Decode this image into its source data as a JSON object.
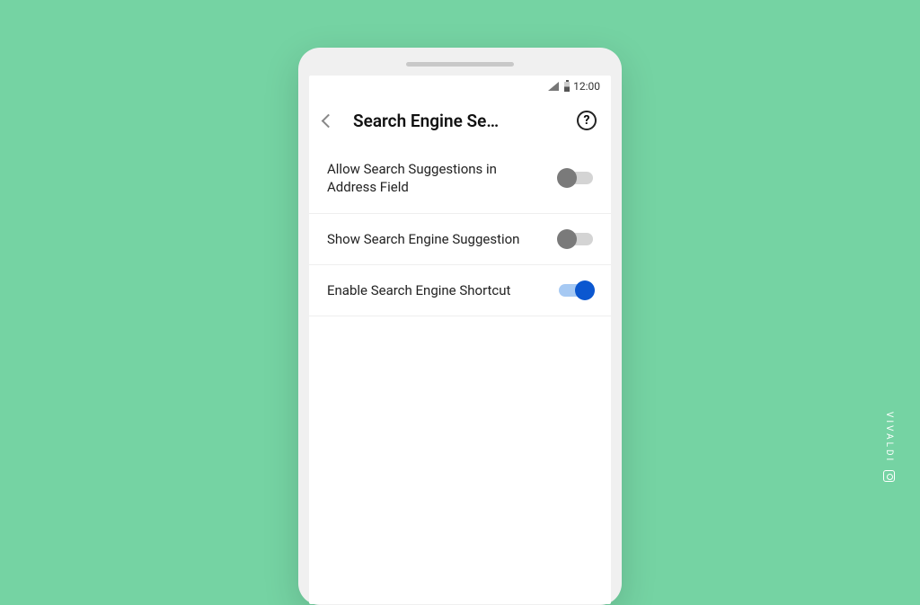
{
  "status_bar": {
    "time": "12:00"
  },
  "header": {
    "title": "Search Engine Se…"
  },
  "settings": [
    {
      "label": "Allow Search Suggestions in Address Field",
      "enabled": false
    },
    {
      "label": "Show Search Engine Suggestion",
      "enabled": false
    },
    {
      "label": "Enable Search Engine Shortcut",
      "enabled": true
    }
  ],
  "brand": "VIVALDI"
}
